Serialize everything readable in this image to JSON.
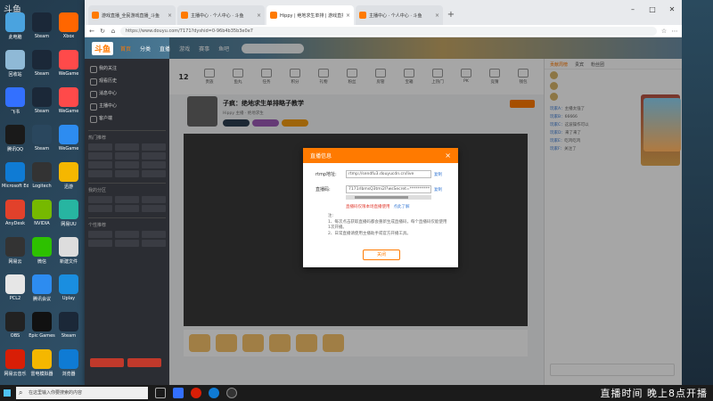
{
  "desktop": {
    "watermark": "斗鱼",
    "icons_left": [
      {
        "label": "此电脑",
        "color": "#4aa3df"
      },
      {
        "label": "回收站",
        "color": "#8fb9d6"
      },
      {
        "label": "飞书",
        "color": "#3370ff"
      },
      {
        "label": "腾讯QQ",
        "color": "#1a1a1a"
      },
      {
        "label": "Microsoft Edge",
        "color": "#0f7bd4"
      },
      {
        "label": "AnyDesk",
        "color": "#e2412b"
      },
      {
        "label": "网易云",
        "color": "#333"
      },
      {
        "label": "PCL2",
        "color": "#e6e6e6"
      },
      {
        "label": "OBS",
        "color": "#222"
      },
      {
        "label": "网易云音乐",
        "color": "#d81e06"
      }
    ],
    "icons_col2": [
      {
        "label": "Steam",
        "color": "#1b2838"
      },
      {
        "label": "Steam",
        "color": "#1b2838"
      },
      {
        "label": "Steam",
        "color": "#1b2838"
      },
      {
        "label": "Steam",
        "color": "#2a475e"
      },
      {
        "label": "Logitech",
        "color": "#333"
      },
      {
        "label": "NVIDIA",
        "color": "#76b900"
      },
      {
        "label": "微信",
        "color": "#2dc100"
      },
      {
        "label": "腾讯会议",
        "color": "#2d8cf0"
      },
      {
        "label": "Epic Games",
        "color": "#111"
      },
      {
        "label": "雷电模拟器",
        "color": "#f5b700"
      }
    ],
    "icons_col3": [
      {
        "label": "Xbox",
        "color": "#ff6600"
      },
      {
        "label": "WeGame",
        "color": "#ff4a4a"
      },
      {
        "label": "WeGame",
        "color": "#ff4a4a"
      },
      {
        "label": "WeGame",
        "color": "#2d8cf0"
      },
      {
        "label": "迅游",
        "color": "#f5b700"
      },
      {
        "label": "网易UU",
        "color": "#27b5a1"
      },
      {
        "label": "新建文件",
        "color": "#ddd"
      },
      {
        "label": "Uplay",
        "color": "#1a8ee0"
      },
      {
        "label": "Steam",
        "color": "#1b2838"
      },
      {
        "label": "浏览器",
        "color": "#0f7bd4"
      }
    ]
  },
  "browser": {
    "tabs": [
      {
        "title": "游戏直播_全民游戏直播_斗鱼",
        "active": false
      },
      {
        "title": "主播中心 · 个人中心 · 斗鱼",
        "active": false
      },
      {
        "title": "Hippy | 绝地求生单排 | 游戏直播",
        "active": true
      },
      {
        "title": "主播中心 · 个人中心 · 斗鱼",
        "active": false
      }
    ],
    "new_tab": "+",
    "url": "https://www.douyu.com/7171?dyshid=0-96b4b35b3e0e7"
  },
  "site": {
    "logo": "斗鱼",
    "nav": [
      "首页",
      "分类",
      "直播",
      "游戏",
      "赛事",
      "鱼吧"
    ],
    "active_nav": 0
  },
  "left_sidebar": {
    "items": [
      "我的关注",
      "观看历史",
      "消息中心",
      "主播中心",
      "客户端"
    ],
    "section1": "热门推荐",
    "section2": "我的分区",
    "section3": "个性推荐"
  },
  "main": {
    "viewer_count": "12",
    "tools": [
      "贵族",
      "鱼丸",
      "任务",
      "积分",
      "礼物",
      "粉丝",
      "房管",
      "宝箱",
      "上热门",
      "PK",
      "竞猜",
      "钱包"
    ],
    "room_title": "子疯：绝地求生单排略子教学",
    "room_sub": "Hippy 主播 · 绝地求生",
    "follow": "关注"
  },
  "chat": {
    "tabs": [
      "贡献周榜",
      "贵宾",
      "粉丝团"
    ],
    "messages": [
      {
        "user": "玩家A",
        "text": "主播太强了"
      },
      {
        "user": "玩家B",
        "text": "66666"
      },
      {
        "user": "玩家C",
        "text": "这波操作可以"
      },
      {
        "user": "玩家D",
        "text": "来了来了"
      },
      {
        "user": "玩家E",
        "text": "吃鸡吃鸡"
      },
      {
        "user": "玩家F",
        "text": "关注了"
      }
    ]
  },
  "modal": {
    "title": "直播信息",
    "close": "×",
    "rtmp_label": "rtmp地址:",
    "rtmp_value": "rtmp://sendfu3.douyucdn.cn/live",
    "code_label": "直播码:",
    "code_value": "7171rlbmsQ3tmi2l?wsSecret=**********",
    "copy": "复制",
    "warn_link": "直播码仅限本场直播使用",
    "help_link": "点此了解",
    "notes": [
      "注:",
      "1、每次点击获取直播码都会重新生成直播码，每个直播码仅能使用1次开播。",
      "2、日常直播请使用主播助手或官方开播工具。"
    ],
    "ok": "关闭"
  },
  "taskbar": {
    "search_placeholder": "在这里输入你要搜索的内容",
    "stream_text": "直播时间 晚上8点开播"
  }
}
